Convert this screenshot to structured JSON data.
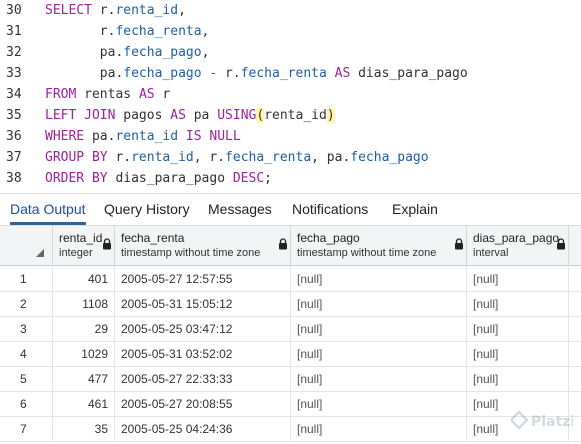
{
  "editor": {
    "lines": [
      {
        "n": "30",
        "tokens": [
          [
            "kw",
            "SELECT "
          ],
          [
            "id",
            "r."
          ],
          [
            "fld",
            "renta_id"
          ],
          [
            "id",
            ","
          ]
        ]
      },
      {
        "n": "31",
        "tokens": [
          [
            "id",
            "       r."
          ],
          [
            "fld",
            "fecha_renta"
          ],
          [
            "id",
            ","
          ]
        ]
      },
      {
        "n": "32",
        "tokens": [
          [
            "id",
            "       pa."
          ],
          [
            "fld",
            "fecha_pago"
          ],
          [
            "id",
            ","
          ]
        ]
      },
      {
        "n": "33",
        "tokens": [
          [
            "id",
            "       pa."
          ],
          [
            "fld",
            "fecha_pago"
          ],
          [
            "op",
            " - "
          ],
          [
            "id",
            "r."
          ],
          [
            "fld",
            "fecha_renta"
          ],
          [
            "kw",
            " AS "
          ],
          [
            "id",
            "dias_para_pago"
          ]
        ]
      },
      {
        "n": "34",
        "tokens": [
          [
            "kw",
            "FROM "
          ],
          [
            "id",
            "rentas "
          ],
          [
            "kw",
            "AS "
          ],
          [
            "id",
            "r"
          ]
        ]
      },
      {
        "n": "35",
        "tokens": [
          [
            "kw",
            "LEFT JOIN "
          ],
          [
            "id",
            "pagos "
          ],
          [
            "kw",
            "AS "
          ],
          [
            "id",
            "pa "
          ],
          [
            "kw",
            "USING"
          ],
          [
            "brk",
            "("
          ],
          [
            "id",
            "renta_id"
          ],
          [
            "brk",
            ")"
          ]
        ]
      },
      {
        "n": "36",
        "tokens": [
          [
            "kw",
            "WHERE "
          ],
          [
            "id",
            "pa."
          ],
          [
            "fld",
            "renta_id"
          ],
          [
            "kw",
            " IS NULL"
          ]
        ]
      },
      {
        "n": "37",
        "tokens": [
          [
            "kw",
            "GROUP BY "
          ],
          [
            "id",
            "r."
          ],
          [
            "fld",
            "renta_id"
          ],
          [
            "id",
            ", r."
          ],
          [
            "fld",
            "fecha_renta"
          ],
          [
            "id",
            ", pa."
          ],
          [
            "fld",
            "fecha_pago"
          ]
        ]
      },
      {
        "n": "38",
        "tokens": [
          [
            "kw",
            "ORDER BY "
          ],
          [
            "id",
            "dias_para_pago "
          ],
          [
            "kw",
            "DESC"
          ],
          [
            "id",
            ";"
          ]
        ]
      }
    ]
  },
  "tabs": [
    {
      "label": "Data Output",
      "active": true
    },
    {
      "label": "Query History",
      "active": false
    },
    {
      "label": "Messages",
      "active": false
    },
    {
      "label": "Notifications",
      "active": false
    },
    {
      "label": "Explain",
      "active": false
    }
  ],
  "columns": [
    {
      "name": "renta_id",
      "type": "integer"
    },
    {
      "name": "fecha_renta",
      "type": "timestamp without time zone"
    },
    {
      "name": "fecha_pago",
      "type": "timestamp without time zone"
    },
    {
      "name": "dias_para_pago",
      "type": "interval"
    }
  ],
  "rows": [
    {
      "idx": "1",
      "renta_id": "401",
      "fecha_renta": "2005-05-27 12:57:55",
      "fecha_pago": "[null]",
      "dias_para_pago": "[null]"
    },
    {
      "idx": "2",
      "renta_id": "1108",
      "fecha_renta": "2005-05-31 15:05:12",
      "fecha_pago": "[null]",
      "dias_para_pago": "[null]"
    },
    {
      "idx": "3",
      "renta_id": "29",
      "fecha_renta": "2005-05-25 03:47:12",
      "fecha_pago": "[null]",
      "dias_para_pago": "[null]"
    },
    {
      "idx": "4",
      "renta_id": "1029",
      "fecha_renta": "2005-05-31 03:52:02",
      "fecha_pago": "[null]",
      "dias_para_pago": "[null]"
    },
    {
      "idx": "5",
      "renta_id": "477",
      "fecha_renta": "2005-05-27 22:33:33",
      "fecha_pago": "[null]",
      "dias_para_pago": "[null]"
    },
    {
      "idx": "6",
      "renta_id": "461",
      "fecha_renta": "2005-05-27 20:08:55",
      "fecha_pago": "[null]",
      "dias_para_pago": "[null]"
    },
    {
      "idx": "7",
      "renta_id": "35",
      "fecha_renta": "2005-05-25 04:24:36",
      "fecha_pago": "[null]",
      "dias_para_pago": "[null]"
    }
  ],
  "watermark": {
    "text": "Platzi"
  },
  "colors": {
    "keyword": "#a020a0",
    "field": "#1f5fa6",
    "active_tab": "#1f4e9c"
  }
}
